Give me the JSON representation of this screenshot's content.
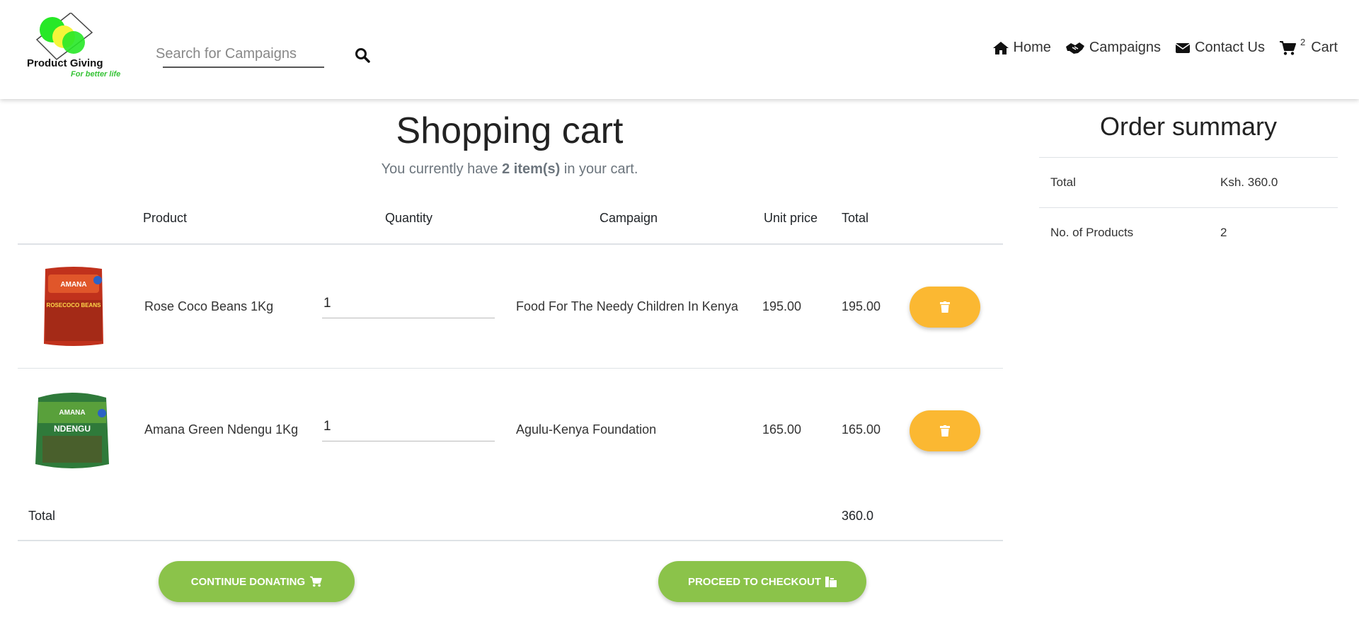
{
  "header": {
    "logo_title": "Product Giving",
    "logo_tagline": "For better life",
    "search_placeholder": "Search for Campaigns",
    "nav": {
      "home": "Home",
      "campaigns": "Campaigns",
      "contact": "Contact Us",
      "cart_count": "2",
      "cart": "Cart"
    }
  },
  "cart": {
    "title": "Shopping cart",
    "subtitle_prefix": "You currently have",
    "subtitle_count": "2 item(s)",
    "subtitle_suffix": "in your cart.",
    "columns": {
      "product": "Product",
      "quantity": "Quantity",
      "campaign": "Campaign",
      "unit_price": "Unit price",
      "total": "Total"
    },
    "items": [
      {
        "product": "Rose Coco Beans 1Kg",
        "quantity": "1",
        "campaign": "Food For The Needy Children In Kenya",
        "unit_price": "195.00",
        "total": "195.00",
        "image_brand": "AMANA",
        "image_label": "ROSECOCO BEANS"
      },
      {
        "product": "Amana Green Ndengu 1Kg",
        "quantity": "1",
        "campaign": "Agulu-Kenya Foundation",
        "unit_price": "165.00",
        "total": "165.00",
        "image_brand": "AMANA",
        "image_label": "NDENGU"
      }
    ],
    "total_label": "Total",
    "total_value": "360.0",
    "continue_label": "CONTINUE DONATING",
    "checkout_label": "PROCEED TO CHECKOUT"
  },
  "summary": {
    "title": "Order summary",
    "rows": [
      {
        "label": "Total",
        "value": "Ksh. 360.0"
      },
      {
        "label": "No. of Products",
        "value": "2"
      }
    ]
  },
  "colors": {
    "accent_green": "#8bc34a",
    "delete_orange": "#fbb832",
    "logo_green": "#35c335"
  }
}
